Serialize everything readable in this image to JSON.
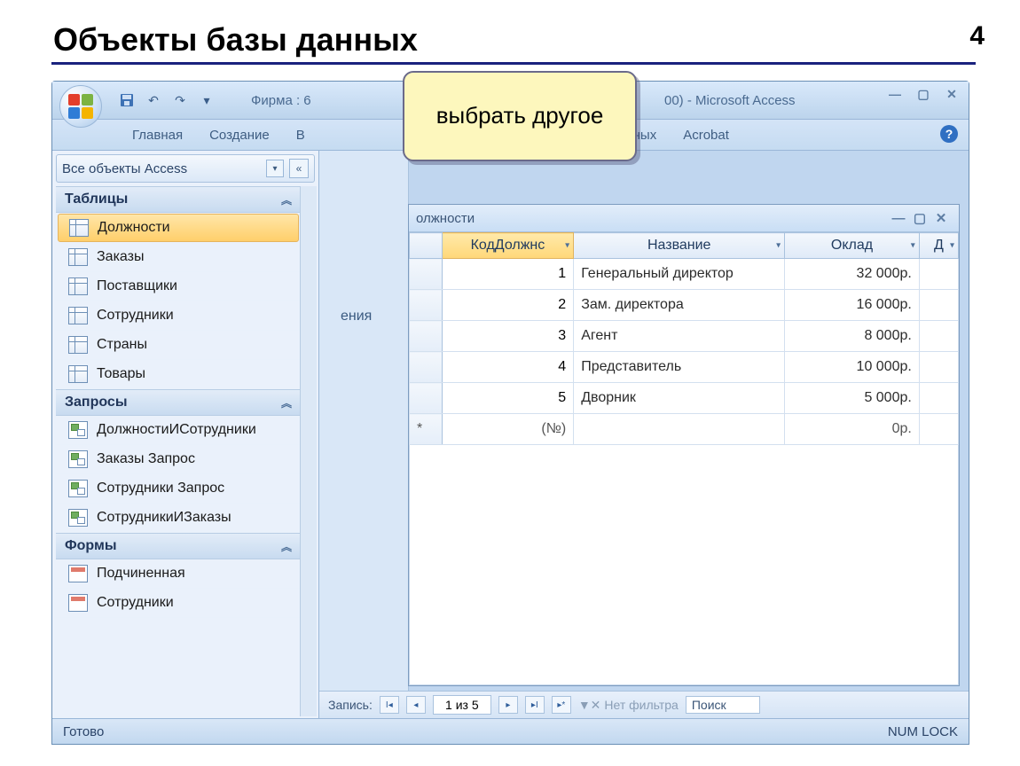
{
  "slide": {
    "title": "Объекты базы данных",
    "number": "4"
  },
  "callout": {
    "text": "выбрать другое"
  },
  "window": {
    "title_prefix": "Фирма : 6",
    "title_suffix": "00) - Microsoft Access",
    "ribbon": {
      "tabs": [
        "Главная",
        "Создание",
        "В",
        "базами данных",
        "Acrobat"
      ]
    }
  },
  "navpane": {
    "header": "Все объекты Access",
    "groups": [
      {
        "title": "Таблицы",
        "kind": "table",
        "items": [
          "Должности",
          "Заказы",
          "Поставщики",
          "Сотрудники",
          "Страны",
          "Товары"
        ],
        "selected": 0
      },
      {
        "title": "Запросы",
        "kind": "query",
        "items": [
          "ДолжностиИСотрудники",
          "Заказы Запрос",
          "Сотрудники Запрос",
          "СотрудникиИЗаказы"
        ]
      },
      {
        "title": "Формы",
        "kind": "form",
        "items": [
          "Подчиненная",
          "Сотрудники"
        ]
      }
    ]
  },
  "midstrip": {
    "hint": "ения"
  },
  "datasheet": {
    "title": "олжности",
    "columns": [
      "КодДолжнс",
      "Название",
      "Оклад",
      "Д"
    ],
    "active_col": 0,
    "rows": [
      {
        "id": "1",
        "name": "Генеральный директор",
        "salary": "32 000р."
      },
      {
        "id": "2",
        "name": "Зам. директора",
        "salary": "16 000р."
      },
      {
        "id": "3",
        "name": "Агент",
        "salary": "8 000р."
      },
      {
        "id": "4",
        "name": "Представитель",
        "salary": "10 000р."
      },
      {
        "id": "5",
        "name": "Дворник",
        "salary": "5 000р."
      }
    ],
    "newrow": {
      "id": "(№)",
      "salary": "0р."
    },
    "recnav": {
      "label": "Запись:",
      "position": "1 из 5",
      "filter": "Нет фильтра",
      "search": "Поиск"
    }
  },
  "statusbar": {
    "left": "Готово",
    "right": "NUM LOCK"
  }
}
